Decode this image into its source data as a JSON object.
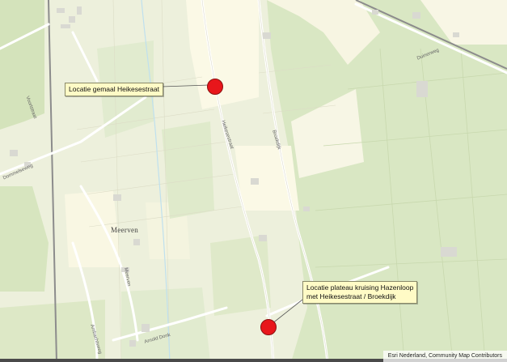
{
  "markers": [
    {
      "label": "Locatie gemaal Heikesestraat"
    },
    {
      "label_line1": "Locatie plateau kruising Hazenloop",
      "label_line2": "met Heikesestraat / Broekdijk"
    }
  ],
  "places": {
    "meerven": "Meerven"
  },
  "roads": {
    "heikesestraat": "Heikesestraat",
    "broekdijk": "Broekdijk",
    "dommelseweg": "Dommelseweg",
    "meerven_road": "Meerven",
    "ambachtsweg": "Ambachtsweg",
    "arnold": "Arnold Donk",
    "voortstraat": "Voortstraat",
    "duinen": "Duinerweg"
  },
  "attribution": "Esri Nederland, Community Map Contributors",
  "colors": {
    "marker": "#e8161b",
    "callout_bg": "#fffbc6",
    "forest": "#d8e6c0",
    "field": "#f7f5e1",
    "road": "#ffffff",
    "rail": "#8c8c8c"
  }
}
